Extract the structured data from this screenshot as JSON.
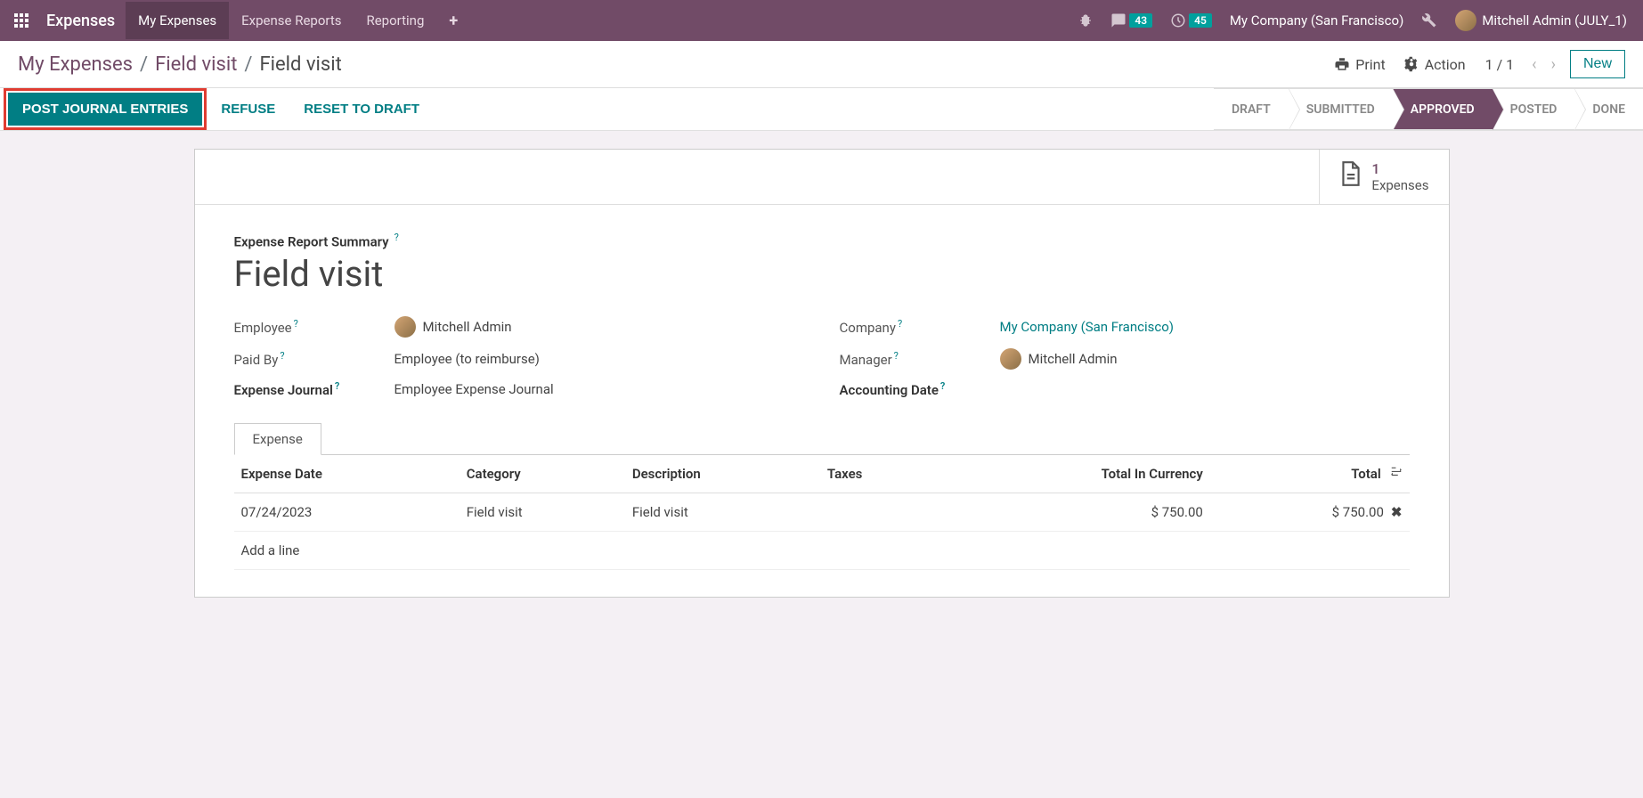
{
  "navbar": {
    "brand": "Expenses",
    "items": [
      "My Expenses",
      "Expense Reports",
      "Reporting"
    ],
    "active_index": 0,
    "msg_count": "43",
    "activity_count": "45",
    "company": "My Company (San Francisco)",
    "user": "Mitchell Admin (JULY_1)"
  },
  "breadcrumb": {
    "items": [
      "My Expenses",
      "Field visit"
    ],
    "current": "Field visit"
  },
  "controls": {
    "print": "Print",
    "action": "Action",
    "pager": "1 / 1",
    "new_btn": "New"
  },
  "actions": {
    "post": "POST JOURNAL ENTRIES",
    "refuse": "REFUSE",
    "reset": "RESET TO DRAFT"
  },
  "status": {
    "steps": [
      "DRAFT",
      "SUBMITTED",
      "APPROVED",
      "POSTED",
      "DONE"
    ],
    "active_index": 2
  },
  "stat": {
    "count": "1",
    "label": "Expenses"
  },
  "form": {
    "summary_label": "Expense Report Summary",
    "title": "Field visit",
    "left": [
      {
        "label": "Employee",
        "value": "Mitchell Admin",
        "avatar": true,
        "help": true
      },
      {
        "label": "Paid By",
        "value": "Employee (to reimburse)",
        "help": true
      },
      {
        "label": "Expense Journal",
        "value": "Employee Expense Journal",
        "bold": true,
        "help": true
      }
    ],
    "right": [
      {
        "label": "Company",
        "value": "My Company (San Francisco)",
        "link": true,
        "help": true
      },
      {
        "label": "Manager",
        "value": "Mitchell Admin",
        "avatar": true,
        "help": true
      },
      {
        "label": "Accounting Date",
        "value": "",
        "bold": true,
        "help": true
      }
    ]
  },
  "table": {
    "tab": "Expense",
    "headers": [
      "Expense Date",
      "Category",
      "Description",
      "Taxes",
      "Total In Currency",
      "Total"
    ],
    "row": {
      "date": "07/24/2023",
      "category": "Field visit",
      "description": "Field visit",
      "taxes": "",
      "total_currency": "$ 750.00",
      "total": "$ 750.00"
    },
    "add_line": "Add a line"
  }
}
